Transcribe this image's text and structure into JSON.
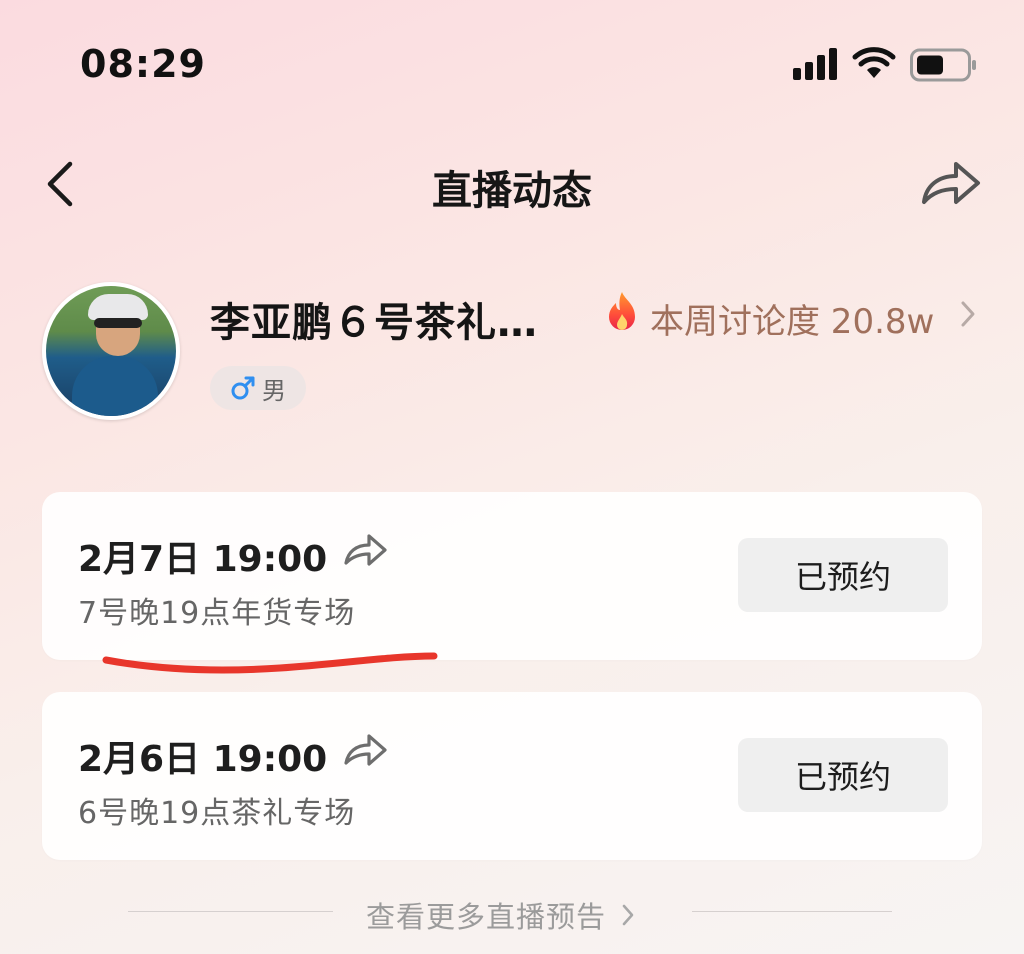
{
  "status_bar": {
    "time": "08:29"
  },
  "nav": {
    "title": "直播动态"
  },
  "profile": {
    "name": "李亚鹏６号茶礼…",
    "gender": "男",
    "heat_label": "本周讨论度 20.8w"
  },
  "schedules": [
    {
      "date": "2月7日 19:00",
      "subtitle": "7号晚19点年货专场",
      "button_label": "已预约"
    },
    {
      "date": "2月6日 19:00",
      "subtitle": "6号晚19点茶礼专场",
      "button_label": "已预约"
    }
  ],
  "footer": {
    "more_label": "查看更多直播预告"
  },
  "colors": {
    "accent_heat": "#a0705c",
    "gender_male": "#2f8ff0",
    "underline_mark": "#e8362b"
  }
}
